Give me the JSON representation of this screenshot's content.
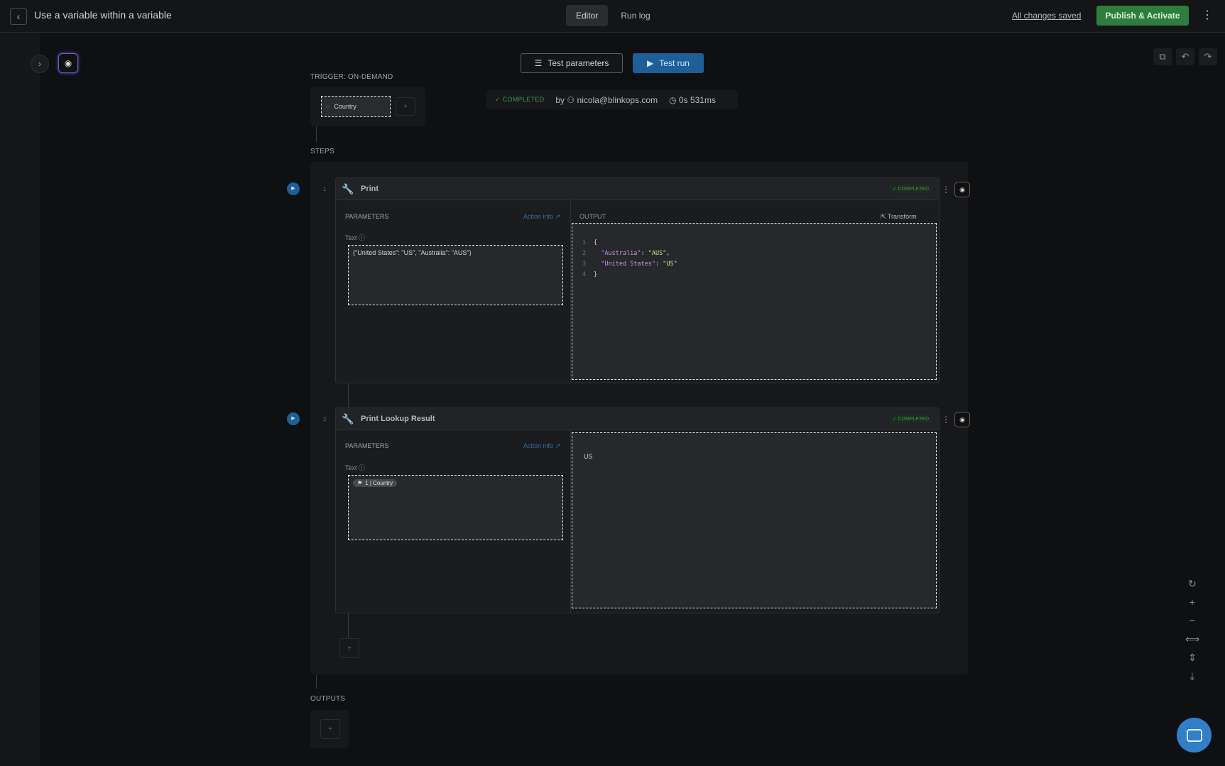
{
  "header": {
    "back_icon": "chevron-left-icon",
    "title": "Use a variable within a variable",
    "tabs": [
      {
        "label": "Editor",
        "active": true
      },
      {
        "label": "Run log",
        "active": false
      }
    ],
    "saved_status": "All changes saved",
    "publish_label": "Publish & Activate",
    "more_icon": "kebab-icon"
  },
  "toolbar": {
    "test_parameters_label": "Test parameters",
    "test_run_label": "Test run"
  },
  "trigger": {
    "label": "TRIGGER: ON-DEMAND",
    "input_name": "Country",
    "add_label": "+"
  },
  "run_status": {
    "status": "COMPLETED",
    "by_label": "by",
    "user": "nicola@blinkops.com",
    "duration": "0s 531ms"
  },
  "steps_label": "STEPS",
  "steps": [
    {
      "index": "1",
      "title": "Print",
      "status": "COMPLETED",
      "params_title": "PARAMETERS",
      "action_info": "Action info",
      "text_label": "Text",
      "text_value": "{\"United States\": \"US\", \"Australia\": \"AUS\"}",
      "output_label": "OUTPUT",
      "transform_label": "Transform",
      "output_lines": [
        {
          "n": "1",
          "text": "{"
        },
        {
          "n": "2",
          "key": "\"Australia\"",
          "sep": ": ",
          "val": "\"AUS\"",
          "end": ","
        },
        {
          "n": "3",
          "key": "\"United States\"",
          "sep": ": ",
          "val": "\"US\"",
          "end": ""
        },
        {
          "n": "4",
          "text": "}"
        }
      ]
    },
    {
      "index": "2",
      "title": "Print Lookup Result",
      "status": "COMPLETED",
      "params_title": "PARAMETERS",
      "action_info": "Action info",
      "text_label": "Text",
      "variable_chip": "1 | Country",
      "output_value": "US"
    }
  ],
  "outputs_label": "OUTPUTS",
  "add_label": "+",
  "colors": {
    "accent_blue": "#1e5f9a",
    "publish_green": "#2e7d3e",
    "status_green": "#3a9a52"
  }
}
